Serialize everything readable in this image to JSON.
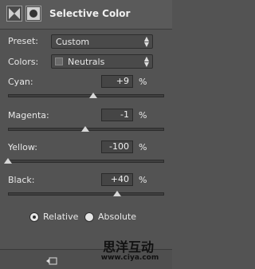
{
  "header": {
    "title": "Selective Color"
  },
  "preset": {
    "label": "Preset:",
    "value": "Custom"
  },
  "colors": {
    "label": "Colors:",
    "value": "Neutrals"
  },
  "sliders": [
    {
      "label": "Cyan:",
      "value": "+9",
      "unit": "%",
      "fraction": 0.545
    },
    {
      "label": "Magenta:",
      "value": "-1",
      "unit": "%",
      "fraction": 0.495
    },
    {
      "label": "Yellow:",
      "value": "-100",
      "unit": "%",
      "fraction": 0.0
    },
    {
      "label": "Black:",
      "value": "+40",
      "unit": "%",
      "fraction": 0.7
    }
  ],
  "method": {
    "relative_label": "Relative",
    "absolute_label": "Absolute",
    "selected": "relative"
  },
  "watermark": {
    "text": "思洋互动",
    "url": "www.ciya.com"
  },
  "colors_ui": {
    "panel_bg": "#535353",
    "thumb": "#d8d8d8"
  },
  "icons": [
    "adjustment-layer-icon",
    "mask-icon",
    "clip-to-layer-icon"
  ]
}
